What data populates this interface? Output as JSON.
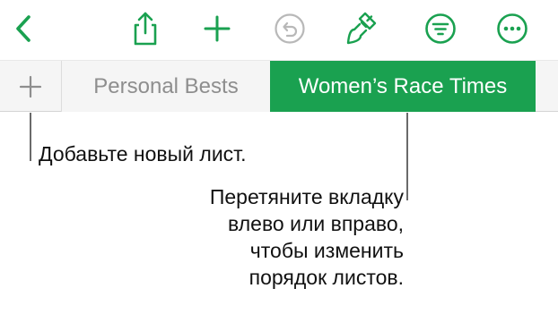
{
  "toolbar": {
    "accent_color": "#1aa150",
    "disabled_color": "#b8b8b8",
    "icons": [
      "back-icon",
      "share-icon",
      "add-icon",
      "undo-icon",
      "format-brush-icon",
      "organize-icon",
      "more-icon"
    ]
  },
  "tabs": {
    "add_label": "+",
    "items": [
      {
        "label": "Personal Bests",
        "active": false
      },
      {
        "label": "Women’s Race Times",
        "active": true
      }
    ]
  },
  "callouts": {
    "add_sheet": "Добавьте новый лист.",
    "reorder": {
      "line1": "Перетяните вкладку",
      "line2": "влево или вправо,",
      "line3": "чтобы изменить",
      "line4": "порядок листов."
    }
  }
}
